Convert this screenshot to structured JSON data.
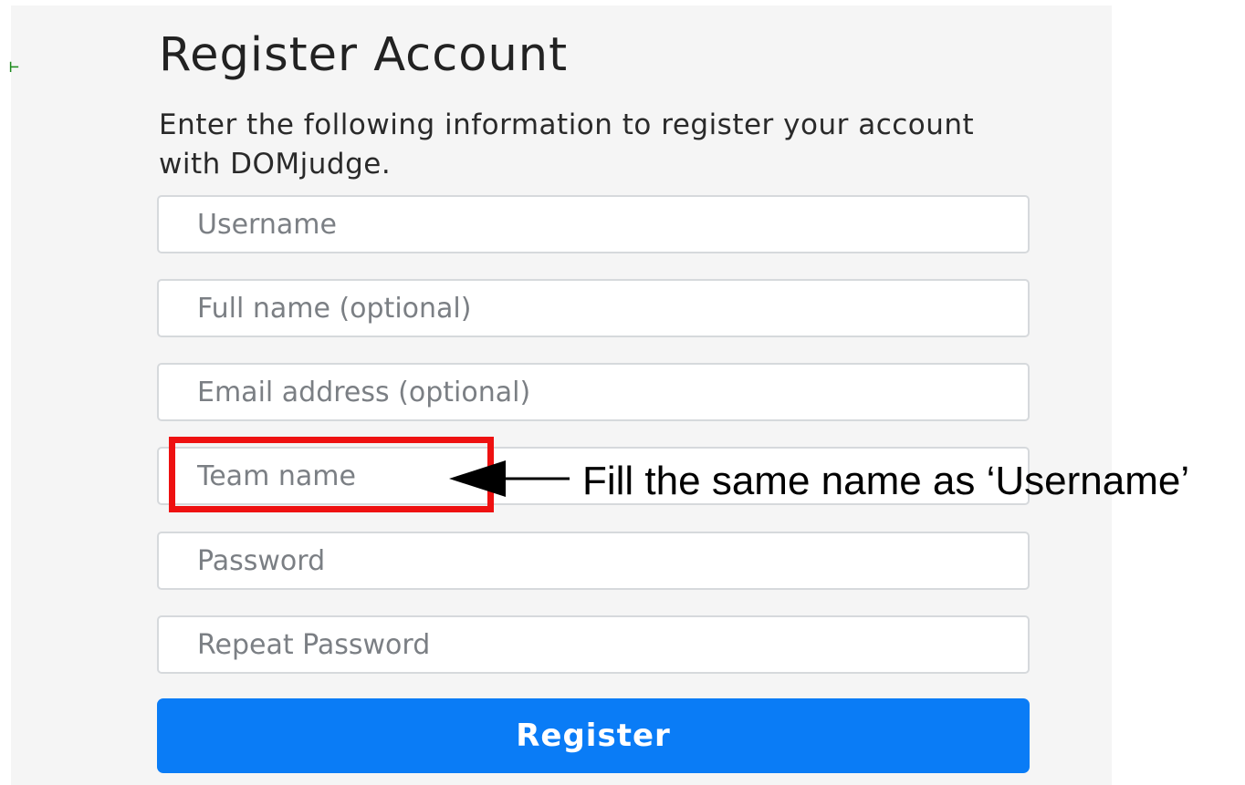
{
  "form": {
    "title": "Register Account",
    "subtitle": "Enter the following information to register your account with DOMjudge.",
    "fields": {
      "username": {
        "placeholder": "Username",
        "value": ""
      },
      "full_name": {
        "placeholder": "Full name (optional)",
        "value": ""
      },
      "email": {
        "placeholder": "Email address (optional)",
        "value": ""
      },
      "team_name": {
        "placeholder": "Team name",
        "value": ""
      },
      "password": {
        "placeholder": "Password",
        "value": ""
      },
      "repeat_password": {
        "placeholder": "Repeat Password",
        "value": ""
      }
    },
    "register_label": "Register"
  },
  "annotation": {
    "text": "Fill the same name as ‘Username’",
    "highlight_color": "#ee1111",
    "arrow_color": "#000000"
  },
  "colors": {
    "background": "#f5f5f5",
    "button": "#0a7cf6",
    "button_text": "#ffffff",
    "field_border": "#d6d9dc",
    "placeholder": "#7b7f84"
  },
  "icons": {
    "corner_mark": "⊢"
  }
}
